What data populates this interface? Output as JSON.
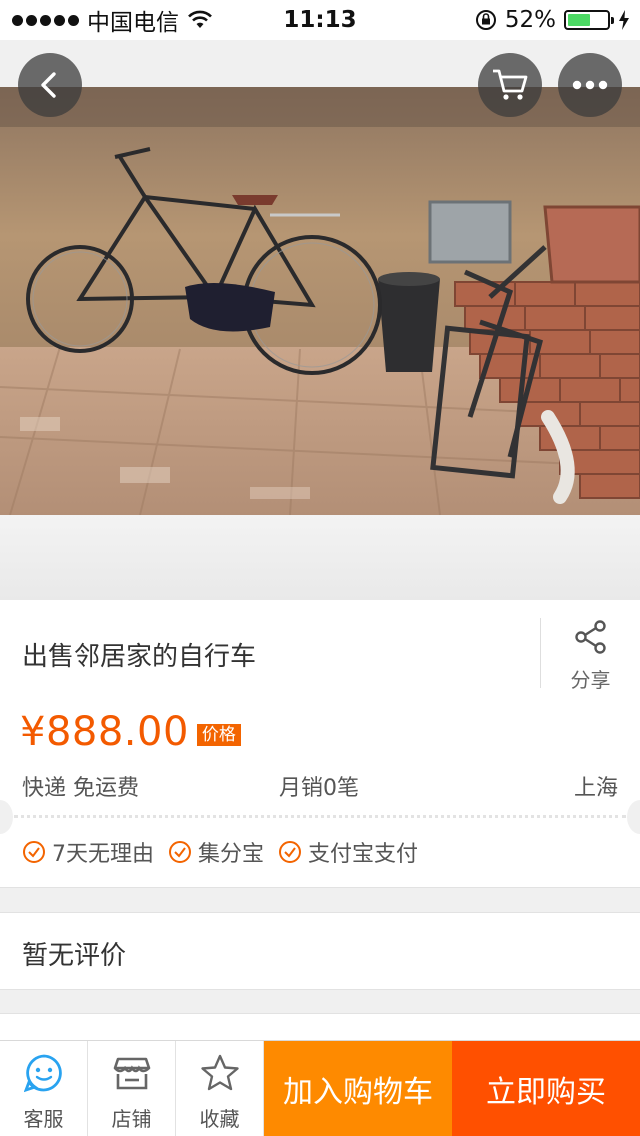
{
  "status_bar": {
    "carrier": "中国电信",
    "time": "11:13",
    "battery_percent": "52%",
    "battery_level": 0.52
  },
  "nav": {
    "back_icon": "chevron-left-icon",
    "cart_icon": "shopping-cart-icon",
    "more_icon": "more-dots-icon"
  },
  "product": {
    "title": "出售邻居家的自行车",
    "share_label": "分享",
    "price": "¥888.00",
    "price_tag": "价格",
    "shipping": "快递 免运费",
    "monthly_sales": "月销0笔",
    "location": "上海",
    "guarantees": [
      "7天无理由",
      "集分宝",
      "支付宝支付"
    ]
  },
  "reviews": {
    "label": "暂无评价"
  },
  "bottom_bar": {
    "service_label": "客服",
    "shop_label": "店铺",
    "favorite_label": "收藏",
    "add_to_cart": "加入购物车",
    "buy_now": "立即购买"
  },
  "colors": {
    "accent": "#f35a00",
    "cart_button": "#fe8a00",
    "buy_button": "#ff5000",
    "service_icon": "#29a3f0"
  }
}
